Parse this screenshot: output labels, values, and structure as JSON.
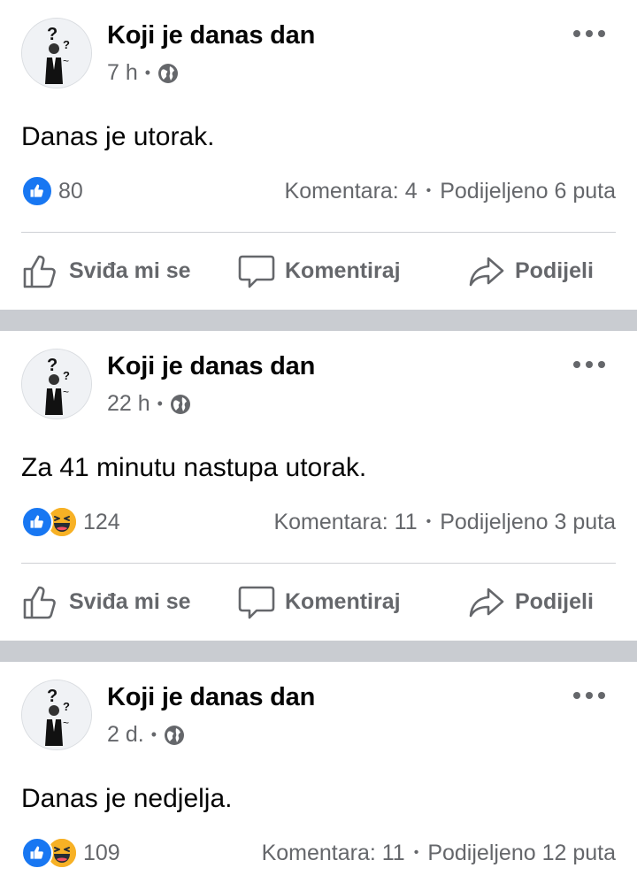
{
  "posts": [
    {
      "page_name": "Koji je danas dan",
      "time": "7 h",
      "text": "Danas je utorak.",
      "reactions": [
        "like"
      ],
      "reaction_count": "80",
      "comments": "Komentara: 4",
      "shares": "Podijeljeno 6 puta"
    },
    {
      "page_name": "Koji je danas dan",
      "time": "22 h",
      "text": "Za 41 minutu nastupa utorak.",
      "reactions": [
        "like",
        "haha"
      ],
      "reaction_count": "124",
      "comments": "Komentara: 11",
      "shares": "Podijeljeno 3 puta"
    },
    {
      "page_name": "Koji je danas dan",
      "time": "2 d.",
      "text": "Danas je nedjelja.",
      "reactions": [
        "like",
        "haha"
      ],
      "reaction_count": "109",
      "comments": "Komentara: 11",
      "shares": "Podijeljeno 12 puta"
    }
  ],
  "actions": {
    "like": "Sviđa mi se",
    "comment": "Komentiraj",
    "share": "Podijeli"
  },
  "icons": {
    "privacy": "globe-icon",
    "more": "more-icon",
    "like_action": "thumbs-up-icon",
    "comment_action": "comment-icon",
    "share_action": "share-icon"
  },
  "colors": {
    "like_blue": "#1877f2",
    "haha_yellow": "#f7b125",
    "secondary_text": "#65676b",
    "separator": "#c9ccd1"
  }
}
